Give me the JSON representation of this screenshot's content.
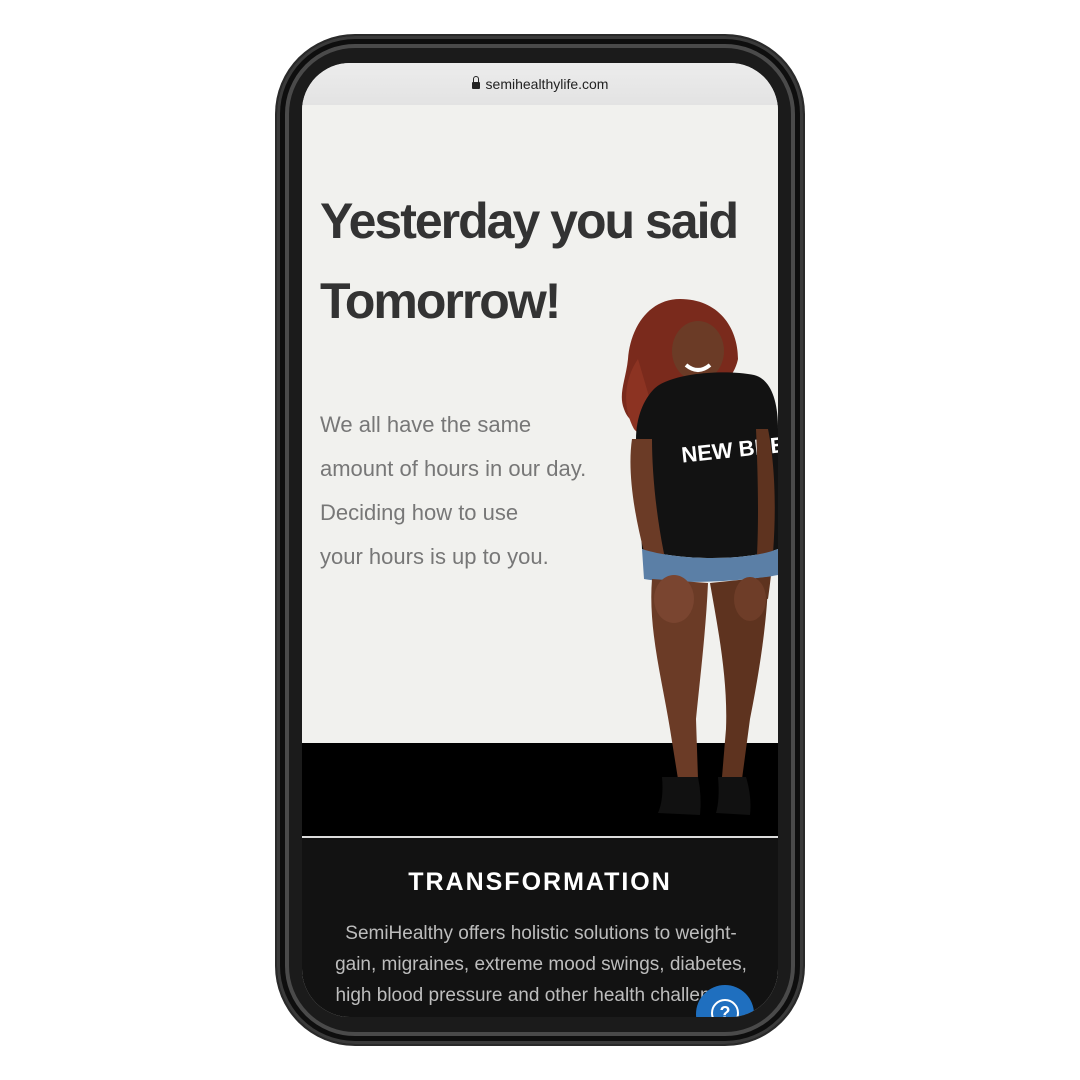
{
  "browser": {
    "url": "semihealthylife.com",
    "lock_icon": "lock-icon"
  },
  "hero": {
    "headline_line1": "Yesterday you said",
    "headline_line2": "Tomorrow!",
    "tagline": [
      "We all have the same",
      "amount of hours in our day.",
      "Deciding how to use",
      "your hours is up to you."
    ],
    "shirt_text": "NEW BREED"
  },
  "transformation": {
    "title": "TRANSFORMATION",
    "body": "SemiHealthy offers holistic solutions to weight-gain, migraines, extreme mood swings, diabetes, high blood pressure and other health challenges. Our...."
  },
  "help_button": {
    "icon": "question-icon",
    "label": "?",
    "color": "#1f6fbf"
  },
  "colors": {
    "hero_bg": "#f1f1ee",
    "headline": "#333333",
    "tagline": "#777777",
    "section_bg": "#121212"
  }
}
